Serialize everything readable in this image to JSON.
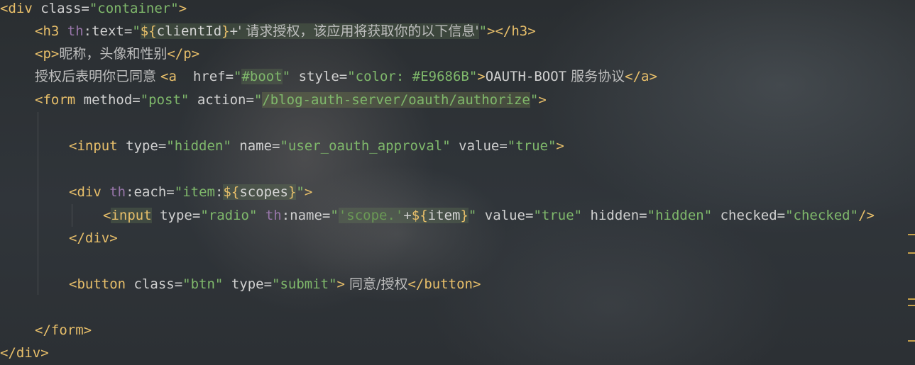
{
  "code": {
    "l1": {
      "open": "<div ",
      "attr": "class",
      "eq": "=",
      "val": "\"container\"",
      "close": ">"
    },
    "l2": {
      "open": "<h3 ",
      "ns": "th",
      "attr": ":text",
      "eq": "=",
      "q1": "\"",
      "tpl_open": "${",
      "ident": "clientId",
      "tpl_close": "}",
      "plus": "+",
      "sq": "' 请求授权，该应用将获取你的以下信息'",
      "q2": "\"",
      "close": "></h3>"
    },
    "l3": {
      "open": "<p>",
      "text": "昵称，头像和性别",
      "close": "</p>"
    },
    "l4": {
      "text": "授权后表明你已同意 ",
      "open": "<a ",
      "attr1": " href",
      "eq1": "=",
      "q1": "\"",
      "val1": "#boot",
      "q2": "\"",
      "attr2": " style",
      "eq2": "=",
      "val2a": "\"color: ",
      "val2b": "#E9686B",
      "val2c": "\"",
      "gt": ">",
      "linktext": "OAUTH-BOOT",
      "linktext2": " 服务协议",
      "close": "</a>"
    },
    "l5": {
      "open": "<form ",
      "attr1": "method",
      "eq1": "=",
      "val1": "\"post\"",
      "attr2": " action",
      "eq2": "=",
      "q1": "\"",
      "val2": "/blog-auth-server/oauth/authorize",
      "q2": "\"",
      "close": ">"
    },
    "l7": {
      "open": "<input ",
      "attr1": "type",
      "eq1": "=",
      "val1": "\"hidden\"",
      "attr2": " name",
      "eq2": "=",
      "val2": "\"user_oauth_approval\"",
      "attr3": " value",
      "eq3": "=",
      "val3": "\"true\"",
      "close": ">"
    },
    "l9": {
      "open": "<div ",
      "ns": "th",
      "attr": ":each",
      "eq": "=",
      "q1": "\"",
      "v1": "item",
      "colon": ":",
      "tpl_open": "${",
      "ident": "scopes",
      "tpl_close": "}",
      "q2": "\"",
      "close": ">"
    },
    "l10": {
      "lt": "<",
      "tagname": "input",
      "attr1": " type",
      "eq1": "=",
      "val1": "\"radio\"",
      "ns": " th",
      "attr2": ":name",
      "eq2": "=",
      "q1": "\"",
      "sq": "'scope.'",
      "plus": "+",
      "tpl_open": "${",
      "ident": "item",
      "tpl_close": "}",
      "q2": "\"",
      "attr3": " value",
      "eq3": "=",
      "val3": "\"true\"",
      "attr4": " hidden",
      "eq4": "=",
      "val4": "\"hidden\"",
      "attr5": " checked",
      "eq5": "=",
      "val5": "\"checked\"",
      "close": "/>"
    },
    "l11": {
      "close": "</div>"
    },
    "l13": {
      "open": "<button ",
      "attr1": "class",
      "eq1": "=",
      "val1": "\"btn\"",
      "attr2": " type",
      "eq2": "=",
      "val2": "\"submit\"",
      "gt": ">",
      "text": " 同意/授权",
      "close": "</button>"
    },
    "l15": {
      "close": "</form>"
    },
    "l16": {
      "close": "</div>"
    }
  },
  "colors": {
    "tag": "#e8bf6a",
    "string": "#7fb86b",
    "namespace": "#9876aa",
    "text": "#bdbdbd",
    "link_color_value": "#E9686B"
  }
}
